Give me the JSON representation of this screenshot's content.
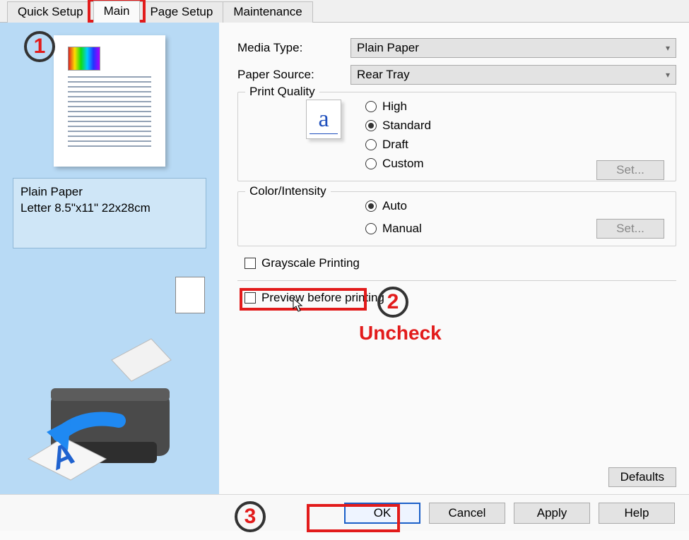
{
  "tabs": {
    "quick_setup": "Quick Setup",
    "main": "Main",
    "page_setup": "Page Setup",
    "maintenance": "Maintenance"
  },
  "left": {
    "paper_type": "Plain Paper",
    "paper_size": "Letter 8.5\"x11\" 22x28cm"
  },
  "settings": {
    "media_type_label": "Media Type:",
    "media_type_value": "Plain Paper",
    "paper_source_label": "Paper Source:",
    "paper_source_value": "Rear Tray",
    "print_quality_title": "Print Quality",
    "quality_options": {
      "high": "High",
      "standard": "Standard",
      "draft": "Draft",
      "custom": "Custom"
    },
    "set_button": "Set...",
    "color_intensity_title": "Color/Intensity",
    "color_options": {
      "auto": "Auto",
      "manual": "Manual"
    },
    "grayscale_label": "Grayscale Printing",
    "preview_label": "Preview before printing",
    "defaults": "Defaults"
  },
  "buttons": {
    "ok": "OK",
    "cancel": "Cancel",
    "apply": "Apply",
    "help": "Help"
  },
  "annotations": {
    "step1": "1",
    "step2": "2",
    "step3": "3",
    "uncheck": "Uncheck"
  }
}
